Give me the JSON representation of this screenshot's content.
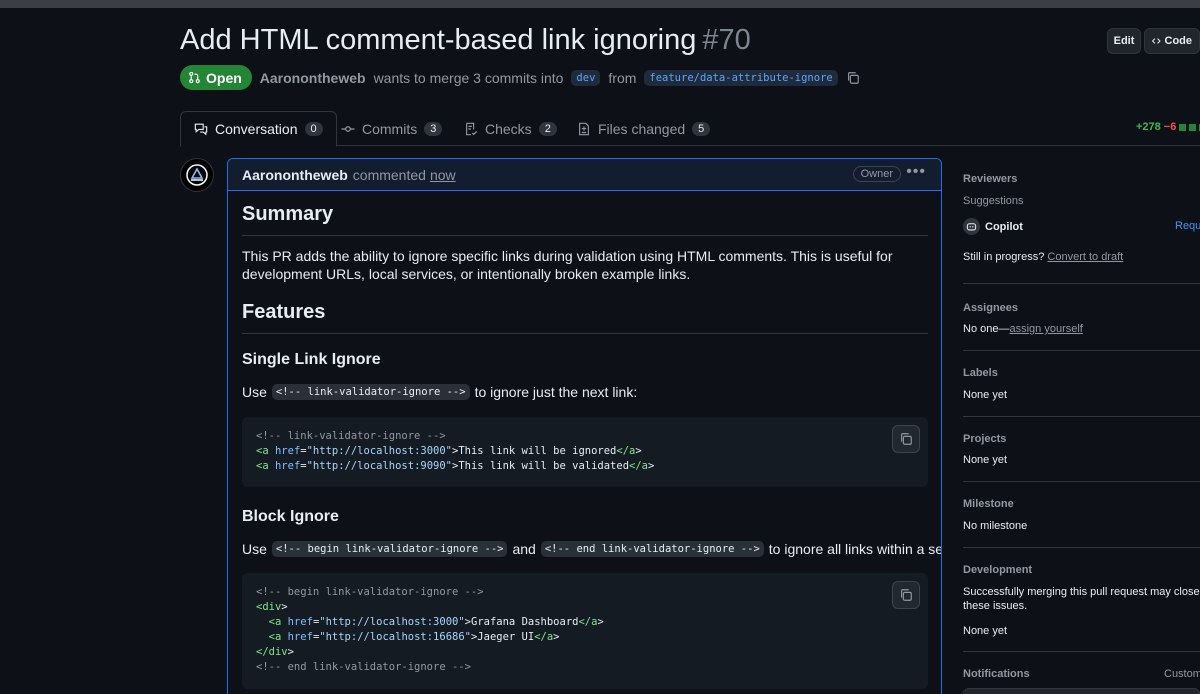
{
  "pr": {
    "title": "Add HTML comment-based link ignoring",
    "number": "#70",
    "state": "Open",
    "author": "Aaronontheweb",
    "merge_text_1": "wants to merge 3 commits into",
    "base_branch": "dev",
    "merge_text_2": "from",
    "head_branch": "feature/data-attribute-ignore"
  },
  "header_buttons": {
    "edit": "Edit",
    "code": "Code"
  },
  "tabs": [
    {
      "label": "Conversation",
      "count": "0",
      "icon": "comment-discussion-icon"
    },
    {
      "label": "Commits",
      "count": "3",
      "icon": "git-commit-icon"
    },
    {
      "label": "Checks",
      "count": "2",
      "icon": "checklist-icon"
    },
    {
      "label": "Files changed",
      "count": "5",
      "icon": "file-diff-icon"
    }
  ],
  "diffstat": {
    "additions": "+278",
    "deletions": "−6"
  },
  "comment": {
    "author": "Aaronontheweb",
    "action": "commented",
    "time": "now",
    "badge": "Owner",
    "summary_heading": "Summary",
    "summary_text": "This PR adds the ability to ignore specific links during validation using HTML comments. This is useful for development URLs, local services, or intentionally broken example links.",
    "features_heading": "Features",
    "single_heading": "Single Link Ignore",
    "single_use": "Use",
    "single_code": "<!-- link-validator-ignore -->",
    "single_tail": "to ignore just the next link:",
    "code1": [
      "<!-- link-validator-ignore -->",
      "<a href=\"http://localhost:3000\">This link will be ignored</a>",
      "<a href=\"http://localhost:9090\">This link will be validated</a>"
    ],
    "block_heading": "Block Ignore",
    "block_use": "Use",
    "block_code_a": "<!-- begin link-validator-ignore -->",
    "block_and": "and",
    "block_code_b": "<!-- end link-validator-ignore -->",
    "block_tail": "to ignore all links within a section:",
    "code2": [
      "<!-- begin link-validator-ignore -->",
      "<div>",
      "  <a href=\"http://localhost:3000\">Grafana Dashboard</a>",
      "  <a href=\"http://localhost:16686\">Jaeger UI</a>",
      "</div>",
      "<!-- end link-validator-ignore -->"
    ]
  },
  "sidebar": {
    "reviewers": {
      "title": "Reviewers",
      "suggestions": "Suggestions",
      "copilot": "Copilot",
      "request": "Requ"
    },
    "draft": {
      "text": "Still in progress?",
      "link": "Convert to draft"
    },
    "assignees": {
      "title": "Assignees",
      "none": "No one—",
      "link": "assign yourself"
    },
    "labels": {
      "title": "Labels",
      "value": "None yet"
    },
    "projects": {
      "title": "Projects",
      "value": "None yet"
    },
    "milestone": {
      "title": "Milestone",
      "value": "No milestone"
    },
    "development": {
      "title": "Development",
      "text1": "Successfully merging this pull request may close",
      "text2": "these issues.",
      "value": "None yet"
    },
    "notifications": {
      "title": "Notifications",
      "custom": "Custom"
    }
  }
}
